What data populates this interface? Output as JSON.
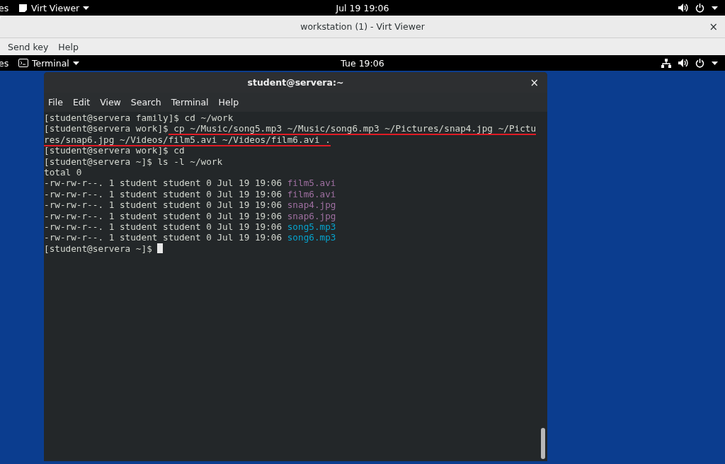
{
  "host_bar": {
    "activities": "es",
    "app": "Virt Viewer",
    "clock": "Jul 19  19:06"
  },
  "viewer": {
    "title": "workstation (1) - Virt Viewer",
    "close": "×",
    "menu": [
      "Send key",
      "Help"
    ]
  },
  "guest_bar": {
    "activities": "es",
    "app": "Terminal",
    "clock": "Tue 19:06"
  },
  "terminal": {
    "title": "student@servera:~",
    "close": "×",
    "menu": [
      "File",
      "Edit",
      "View",
      "Search",
      "Terminal",
      "Help"
    ],
    "lines": [
      {
        "kind": "text",
        "text": "[student@servera family]$ cd ~/work"
      },
      {
        "kind": "marked",
        "text": "[student@servera work]$",
        "marked": " cp ~/Music/song5.mp3 ~/Music/song6.mp3 ~/Pictures/snap4.jpg ~/Pictu"
      },
      {
        "kind": "marked",
        "marked": "res/snap6.jpg ~/Videos/film5.avi ~/Videos/film6.avi ."
      },
      {
        "kind": "text",
        "text": "[student@servera work]$ cd"
      },
      {
        "kind": "text",
        "text": "[student@servera ~]$ ls -l ~/work"
      },
      {
        "kind": "text",
        "text": "total 0"
      },
      {
        "kind": "file",
        "text": "-rw-rw-r--. 1 student student 0 Jul 19 19:06 ",
        "name": "film5.avi",
        "color": "#9e6fa0"
      },
      {
        "kind": "file",
        "text": "-rw-rw-r--. 1 student student 0 Jul 19 19:06 ",
        "name": "film6.avi",
        "color": "#9e6fa0"
      },
      {
        "kind": "file",
        "text": "-rw-rw-r--. 1 student student 0 Jul 19 19:06 ",
        "name": "snap4.jpg",
        "color": "#9e6fa0"
      },
      {
        "kind": "file",
        "text": "-rw-rw-r--. 1 student student 0 Jul 19 19:06 ",
        "name": "snap6.jpg",
        "color": "#9e6fa0"
      },
      {
        "kind": "file",
        "text": "-rw-rw-r--. 1 student student 0 Jul 19 19:06 ",
        "name": "song5.mp3",
        "color": "#06a2cc"
      },
      {
        "kind": "file",
        "text": "-rw-rw-r--. 1 student student 0 Jul 19 19:06 ",
        "name": "song6.mp3",
        "color": "#06a2cc"
      },
      {
        "kind": "prompt",
        "text": "[student@servera ~]$ ",
        "cursor": true
      }
    ]
  }
}
